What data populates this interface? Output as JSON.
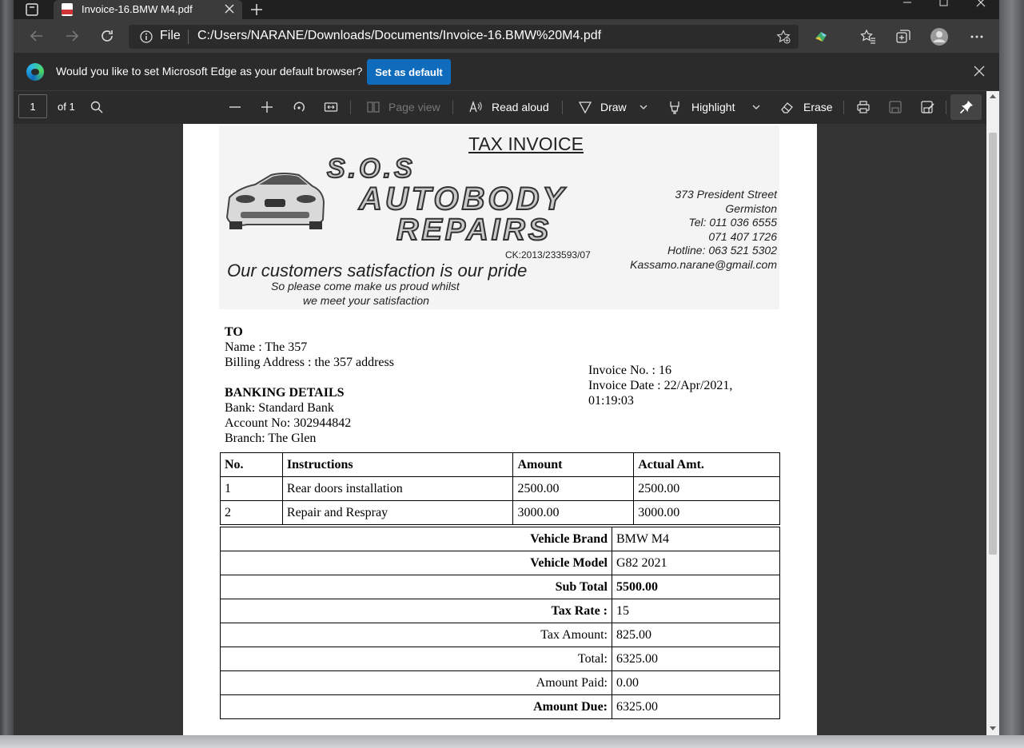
{
  "browser": {
    "tab_title": "Invoice-16.BMW M4.pdf",
    "file_label": "File",
    "url": "C:/Users/NARANE/Downloads/Documents/Invoice-16.BMW%20M4.pdf"
  },
  "infobar": {
    "message": "Would you like to set Microsoft Edge as your default browser?",
    "button": "Set as default"
  },
  "pdf_toolbar": {
    "page": "1",
    "of": "of 1",
    "page_view": "Page view",
    "read_aloud": "Read aloud",
    "draw": "Draw",
    "highlight": "Highlight",
    "erase": "Erase"
  },
  "letterhead": {
    "title": "TAX INVOICE",
    "logo_line1": "S.O.S",
    "logo_line2": "AUTOBODY",
    "logo_line3": "REPAIRS",
    "ck": "CK:2013/233593/07",
    "address": [
      "373 President Street",
      "Germiston",
      "Tel: 011 036 6555",
      "071 407 1726",
      "Hotline: 063 521 5302",
      "Kassamo.narane@gmail.com"
    ],
    "slogan": "Our customers satisfaction is our pride",
    "slogan2": "So please come make us proud whilst",
    "slogan3": "we meet your satisfaction"
  },
  "to": {
    "heading": "TO",
    "name": "Name : The 357",
    "billing": "Billing Address : the 357 address"
  },
  "invoice_info": {
    "number": "Invoice No. : 16",
    "date": "Invoice Date : 22/Apr/2021,",
    "time": "01:19:03"
  },
  "banking": {
    "heading": "BANKING DETAILS",
    "bank": "Bank: Standard Bank",
    "account": "Account No: 302944842",
    "branch": "Branch: The Glen"
  },
  "items_table": {
    "headers": [
      "No.",
      "Instructions",
      "Amount",
      "Actual Amt."
    ],
    "rows": [
      [
        "1",
        "Rear doors installation",
        "2500.00",
        "2500.00"
      ],
      [
        "2",
        "Repair and Respray",
        "3000.00",
        "3000.00"
      ]
    ]
  },
  "totals": [
    {
      "label": "Vehicle Brand",
      "value": "BMW M4"
    },
    {
      "label": "Vehicle Model",
      "value": "G82 2021"
    },
    {
      "label": "Sub Total",
      "value": "5500.00"
    },
    {
      "label": "Tax Rate :",
      "value": "15"
    },
    {
      "label": "Tax Amount:",
      "value": "825.00"
    },
    {
      "label": "Total:",
      "value": "6325.00"
    },
    {
      "label": "Amount Paid:",
      "value": "0.00"
    },
    {
      "label": "Amount Due:",
      "value": "6325.00"
    }
  ],
  "colors": {
    "accent": "#0f6cbd",
    "toolbar_bg": "#2b2b2b",
    "titlebar_bg": "#202020"
  }
}
